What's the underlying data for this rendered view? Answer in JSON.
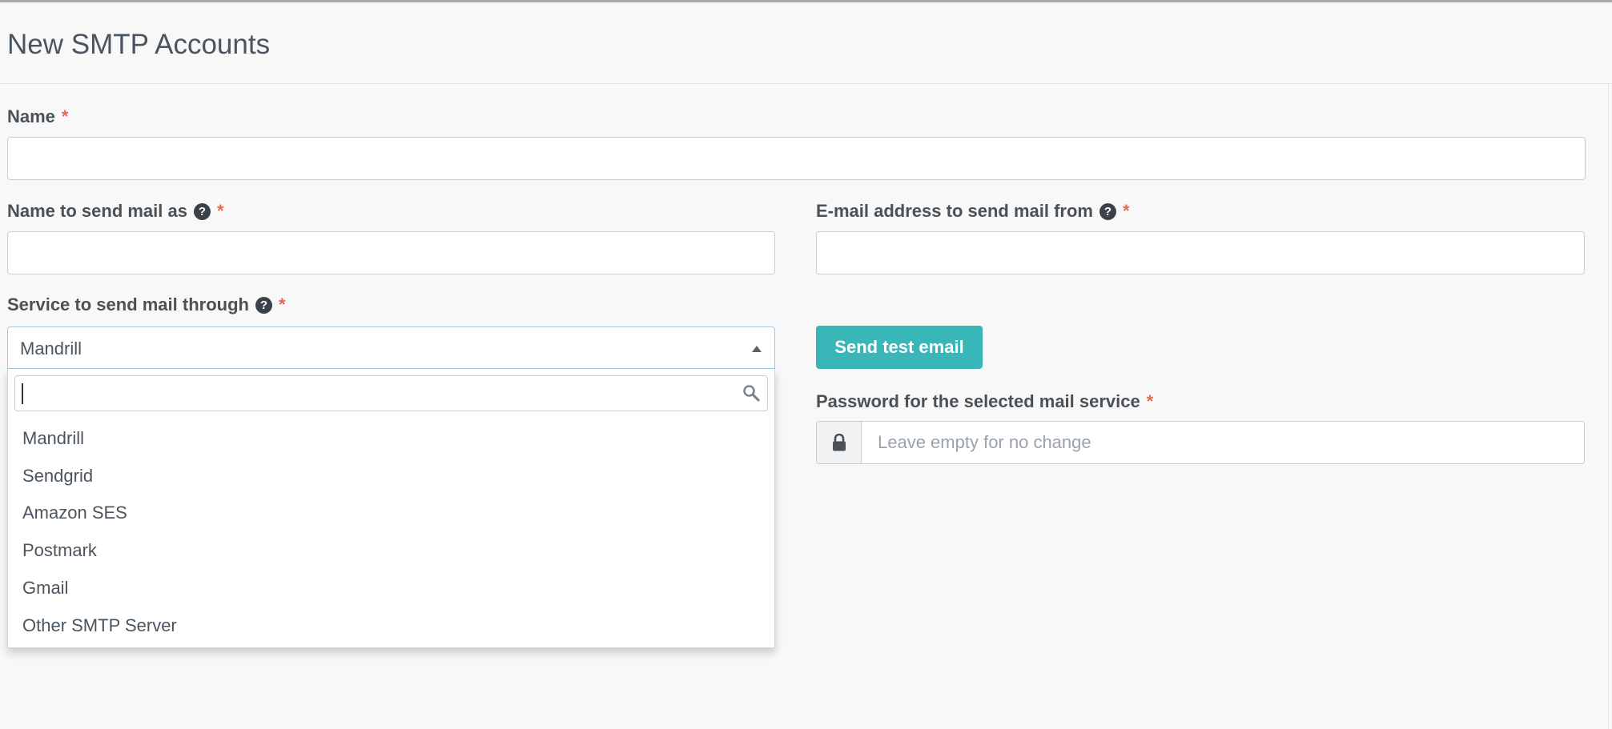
{
  "page": {
    "title": "New SMTP Accounts"
  },
  "form": {
    "name": {
      "label": "Name",
      "required": "*",
      "value": ""
    },
    "send_as": {
      "label": "Name to send mail as",
      "help": "?",
      "required": "*",
      "value": ""
    },
    "from_email": {
      "label": "E-mail address to send mail from",
      "help": "?",
      "required": "*",
      "value": ""
    },
    "service": {
      "label": "Service to send mail through",
      "help": "?",
      "required": "*",
      "selected": "Mandrill",
      "search_value": "",
      "options": [
        "Mandrill",
        "Sendgrid",
        "Amazon SES",
        "Postmark",
        "Gmail",
        "Other SMTP Server"
      ]
    },
    "test_button": {
      "label": "Send test email"
    },
    "password": {
      "label": "Password for the selected mail service",
      "required": "*",
      "placeholder": "Leave empty for no change",
      "icon": "lock-icon"
    }
  },
  "colors": {
    "accent": "#38b6b8",
    "required": "#e26b52",
    "focus_border": "#9ec9e9"
  }
}
